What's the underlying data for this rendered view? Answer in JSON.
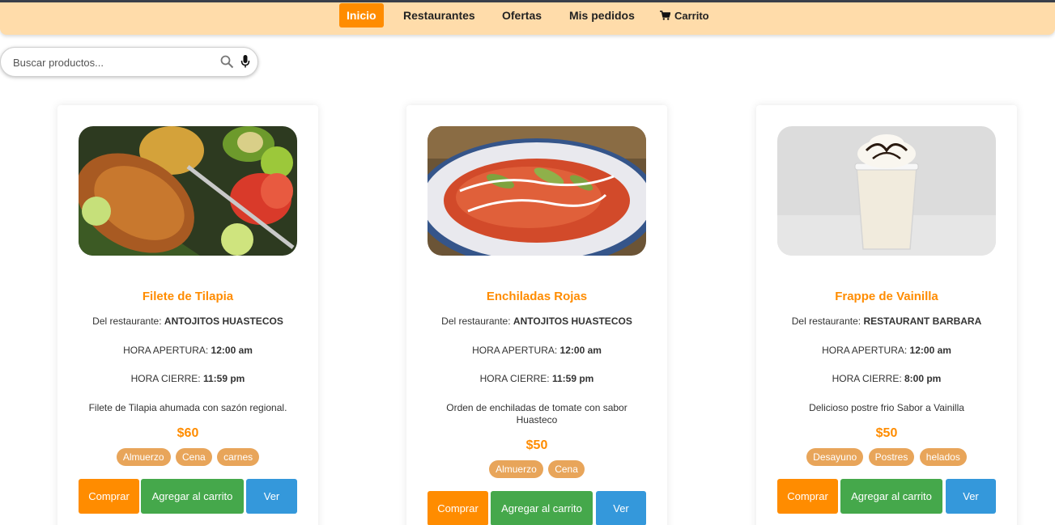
{
  "nav": {
    "items": [
      {
        "label": "Inicio",
        "active": true
      },
      {
        "label": "Restaurantes",
        "active": false
      },
      {
        "label": "Ofertas",
        "active": false
      },
      {
        "label": "Mis pedidos",
        "active": false
      }
    ],
    "cart_label": "Carrito",
    "cart_icon": "cart-icon"
  },
  "search": {
    "placeholder": "Buscar productos...",
    "value": "",
    "icons": [
      "search-icon",
      "microphone-icon"
    ]
  },
  "labels": {
    "restaurant_prefix": "Del restaurante:",
    "open_prefix": "HORA APERTURA:",
    "close_prefix": "HORA CIERRE:",
    "buy": "Comprar",
    "add_to_cart": "Agregar al carrito",
    "view": "Ver"
  },
  "products": [
    {
      "name": "Filete de Tilapia",
      "restaurant": "ANTOJITOS HUASTECOS",
      "open_time": "12:00 am",
      "close_time": "11:59 pm",
      "description": "Filete de Tilapia ahumada con sazón regional.",
      "price": "$60",
      "tags": [
        "Almuerzo",
        "Cena",
        "carnes"
      ]
    },
    {
      "name": "Enchiladas Rojas",
      "restaurant": "ANTOJITOS HUASTECOS",
      "open_time": "12:00 am",
      "close_time": "11:59 pm",
      "description": "Orden de enchiladas de tomate con sabor Huasteco",
      "price": "$50",
      "tags": [
        "Almuerzo",
        "Cena"
      ]
    },
    {
      "name": "Frappe de Vainilla",
      "restaurant": "RESTAURANT BARBARA",
      "open_time": "12:00 am",
      "close_time": "8:00 pm",
      "description": "Delicioso postre frio Sabor a Vainilla",
      "price": "$50",
      "tags": [
        "Desayuno",
        "Postres",
        "helados"
      ]
    }
  ],
  "colors": {
    "accent": "#ff8c00",
    "navbar_bg": "#ffdcaa",
    "tag_bg": "#e8a55a",
    "add_button": "#45a84b",
    "view_button": "#3498db"
  }
}
